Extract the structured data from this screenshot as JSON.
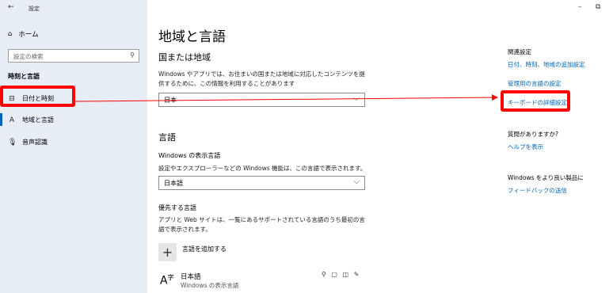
{
  "window": {
    "title": "設定",
    "minimize": "–",
    "maximize": "⧉"
  },
  "sidebar": {
    "home": "ホーム",
    "search_placeholder": "設定の検索",
    "section": "時刻と言語",
    "items": [
      {
        "label": "日付と時刻",
        "icon": "calendar-clock-icon"
      },
      {
        "label": "地域と言語",
        "icon": "globe-language-icon"
      },
      {
        "label": "音声認識",
        "icon": "microphone-icon"
      }
    ]
  },
  "main": {
    "title": "地域と言語",
    "region": {
      "heading": "国または地域",
      "description": "Windows やアプリでは、お住まいの国または地域に対応したコンテンツを提供するために、この情報を利用することがあります",
      "value": "日本"
    },
    "language": {
      "heading": "言語",
      "display_label": "Windows の表示言語",
      "display_desc": "設定やエクスプローラーなどの Windows 機能は、この言語で表示されます。",
      "display_value": "日本語",
      "preferred_label": "優先する言語",
      "preferred_desc": "アプリと Web サイトは、一覧にあるサポートされている言語のうち最初の言語で表示されます。",
      "add_label": "言語を追加する",
      "lang_name": "日本語",
      "lang_sub": "Windows の表示言語",
      "lang_features": "⚲ ▢ ◫ ✎"
    }
  },
  "related": {
    "heading": "関連設定",
    "link1": "日付、時刻、地域の追加設定",
    "link2": "管理用の言語の設定",
    "link3": "キーボードの詳細設定",
    "question": "質問がありますか?",
    "help": "ヘルプを表示",
    "improve": "Windows をより良い製品に",
    "feedback": "フィードバックの送信"
  },
  "colors": {
    "accent": "#0067b8",
    "highlight": "#ff0000",
    "sidebar_bg": "#e6edf5"
  }
}
